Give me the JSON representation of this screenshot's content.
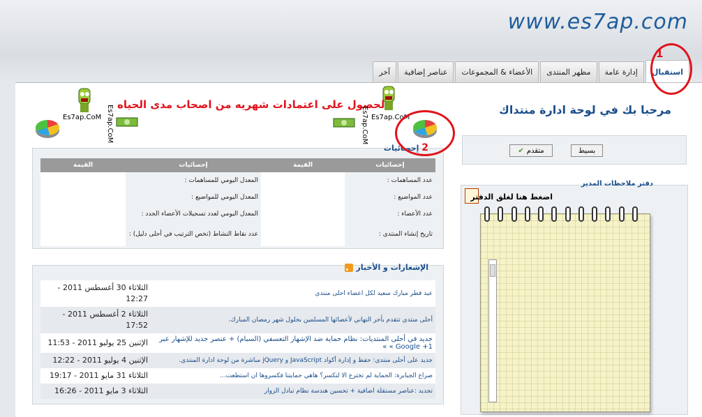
{
  "site_url": "www.es7ap.com",
  "tabs": [
    {
      "label": "استقبال"
    },
    {
      "label": "إدارة عامة"
    },
    {
      "label": "مظهر المنتدى"
    },
    {
      "label": "الأعضاء & المجموعات"
    },
    {
      "label": "عناصر إضافية"
    },
    {
      "label": "آخر"
    }
  ],
  "annotations": {
    "num1": "1",
    "num2": "2"
  },
  "welcome": "مرحبا بك في لوحة ادارة منتداك",
  "promo": "الحصول على اعتمادات شهريه من اصحاب مدى الحياه",
  "brand": "Es7ap.CoM",
  "mode": {
    "simple": "بسيط",
    "advanced": "متقدم"
  },
  "stats": {
    "title": "إحصائيات",
    "headers": [
      "إحصائيات",
      "القيمة",
      "إحصائيات",
      "القيمة"
    ],
    "rows": [
      [
        "عدد المساهمات :",
        "",
        "المعدل اليومي للمساهمات :",
        ""
      ],
      [
        "عدد المواضيع :",
        "",
        "المعدل اليومي للمواضيع :",
        ""
      ],
      [
        "عدد الأعضاء :",
        "",
        "المعدل اليومي لعدد تسجيلات الأعضاء الجدد :",
        ""
      ],
      [
        "تاريخ إنشاء المنتدى :",
        "",
        "عدد نقاط النشاط (تخص الترتيب في أحلى دليل) :",
        ""
      ]
    ]
  },
  "news": {
    "title": "الإشعارات و الأخبار",
    "items": [
      {
        "text": "عيد فطر مبارك سعيد لكل اعضاء احلى منتدى",
        "date": "الثلاثاء 30 أغسطس 2011 - 12:27"
      },
      {
        "text": "أحلى منتدى تتقدم بأحر التهاني لأعضائها المسلمين بحلول شهر رمضان المبارك.",
        "date": "الثلاثاء 2 أغسطس 2011 - 17:52"
      },
      {
        "text": "جديد في أحلى المنتديات: نظام حماية ضد الإشهار التعسفي (السبام) + عنصر جديد للإشهار عبر Google +1 » »",
        "date": "الإثنين 25 يوليو 2011 - 11:53"
      },
      {
        "text": "جديد على أحلى منتدى: حفظ و إدارة أكواد JavaScript و jQuery مباشرة من لوحة ادارة المنتدى.",
        "date": "الإثنين 4 يوليو 2011 - 12:22"
      },
      {
        "text": "صراع الجبابرة: الحماية لم تخترع الا لتكسر؟ هاهي حمايتنا فكسروها ان استطعت...",
        "date": "الثلاثاء 31 مايو 2011 - 19:17"
      },
      {
        "text": "تجديد :عناصر مستقلة اضافية + تحسين هندسة نظام تبادل الزوار",
        "date": "الثلاثاء 3 مايو 2011 - 16:26"
      }
    ]
  },
  "notes": {
    "title": "دفتر ملاحظات المدير",
    "link": "اضغط هنا لغلق الدفتر"
  },
  "colors": {
    "accent": "#1a4e8a",
    "annotation": "#e0131c"
  }
}
